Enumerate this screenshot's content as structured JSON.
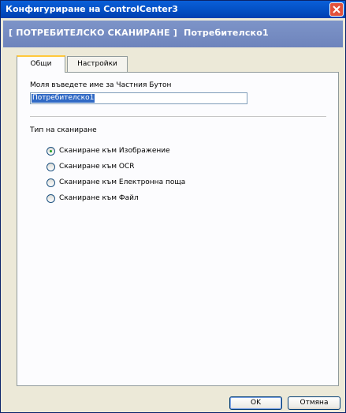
{
  "window": {
    "title": "Конфигуриране на ControlCenter3"
  },
  "header": {
    "text": "[ ПОТРЕБИТЕЛСКО СКАНИРАНЕ ]  Потребителско1"
  },
  "tabs": [
    {
      "label": "Общи",
      "active": true
    },
    {
      "label": "Настройки",
      "active": false
    }
  ],
  "general": {
    "name_label": "Моля въведете име за Частния Бутон",
    "name_value": "Потребителско1",
    "scan_type_label": "Тип на сканиране",
    "scan_options": [
      {
        "label": "Сканиране към Изображение",
        "checked": true
      },
      {
        "label": "Сканиране към OCR",
        "checked": false
      },
      {
        "label": "Сканиране към Електронна поща",
        "checked": false
      },
      {
        "label": "Сканиране към Файл",
        "checked": false
      }
    ]
  },
  "buttons": {
    "ok": "OK",
    "cancel": "Отмяна"
  }
}
